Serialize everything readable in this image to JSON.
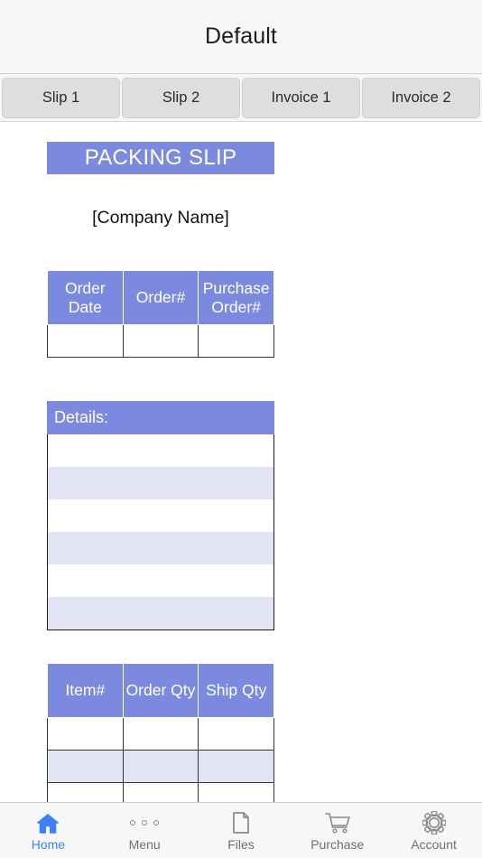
{
  "header": {
    "title": "Default"
  },
  "tabs": [
    {
      "label": "Slip 1",
      "active": true
    },
    {
      "label": "Slip 2",
      "active": false
    },
    {
      "label": "Invoice 1",
      "active": false
    },
    {
      "label": "Invoice 2",
      "active": false
    }
  ],
  "document": {
    "banner_title": "PACKING SLIP",
    "company_name": "[Company Name]",
    "order_table": {
      "headers": [
        "Order Date",
        "Order#",
        "Purchase Order#"
      ],
      "rows": [
        [
          "",
          "",
          ""
        ]
      ]
    },
    "details": {
      "label": "Details:",
      "rows": [
        "",
        "",
        "",
        "",
        "",
        ""
      ]
    },
    "items_table": {
      "headers": [
        "Item#",
        "Order Qty",
        "Ship Qty"
      ],
      "rows": [
        [
          "",
          "",
          ""
        ],
        [
          "",
          "",
          ""
        ],
        [
          "",
          "",
          ""
        ]
      ]
    }
  },
  "bottom_nav": [
    {
      "label": "Home",
      "icon": "home-icon",
      "active": true
    },
    {
      "label": "Menu",
      "icon": "dots-icon",
      "active": false
    },
    {
      "label": "Files",
      "icon": "document-icon",
      "active": false
    },
    {
      "label": "Purchase",
      "icon": "cart-icon",
      "active": false
    },
    {
      "label": "Account",
      "icon": "gear-icon",
      "active": false
    }
  ],
  "colors": {
    "accent_header": "#7b8ade",
    "row_alt": "#e3e3f6",
    "active_nav": "#3b82f6",
    "tab_fill": "#dedede",
    "chrome_bg": "#f7f7f7"
  }
}
